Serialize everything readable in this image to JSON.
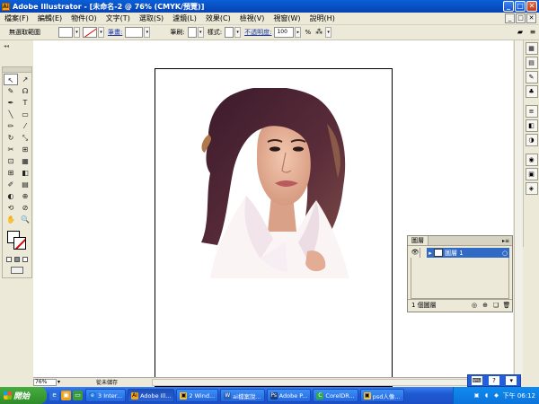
{
  "window": {
    "title": "Adobe Illustrator - [未命名-2 @ 76% (CMYK/預覽)]",
    "app_icon": "Ai",
    "buttons": [
      "_",
      "□",
      "✕"
    ]
  },
  "menubar": {
    "items": [
      "檔案(F)",
      "編輯(E)",
      "物件(O)",
      "文字(T)",
      "選取(S)",
      "濾鏡(L)",
      "效果(C)",
      "檢視(V)",
      "視窗(W)",
      "說明(H)"
    ],
    "doc_buttons": [
      "_",
      "□",
      "✕"
    ]
  },
  "controlbar": {
    "selection_status": "無選取範圍",
    "stroke_label": "筆畫:",
    "brush_label": "筆刷:",
    "style_label": "樣式:",
    "opacity_label": "不透明度:",
    "opacity_value": "100",
    "percent_sign": "%"
  },
  "tools": [
    "↖",
    "↗",
    "✎",
    "☊",
    "✒",
    "T",
    "╲",
    "▭",
    "✏",
    "⁄",
    "↻",
    "⤡",
    "✂",
    "⊞",
    "⊡",
    "▦",
    "⊞",
    "◧",
    "✐",
    "▤",
    "◐",
    "⊕",
    "⟲",
    "⊘",
    "✋",
    "🔍"
  ],
  "statusbar": {
    "zoom": "76%",
    "status": "從未儲存"
  },
  "layers_panel": {
    "tab": "圖層",
    "layer_name": "圖層 1",
    "count": "1 個圖層"
  },
  "taskbar": {
    "start": "開始",
    "buttons": [
      {
        "label": "3 Inter...",
        "icon": "e",
        "color": "#1e74d8"
      },
      {
        "label": "Adobe Ill...",
        "icon": "Ai",
        "color": "#f7a21b",
        "active": true
      },
      {
        "label": "2 Wind...",
        "icon": "▣",
        "color": "#f0c040"
      },
      {
        "label": "ai檔案說...",
        "icon": "W",
        "color": "#2b5fb8"
      },
      {
        "label": "Adobe P...",
        "icon": "Ps",
        "color": "#1c3f7a"
      },
      {
        "label": "CorelDR...",
        "icon": "C",
        "color": "#2fa84f"
      },
      {
        "label": "psd人像...",
        "icon": "▣",
        "color": "#f0c040"
      }
    ],
    "clock": "下午 06:12"
  }
}
